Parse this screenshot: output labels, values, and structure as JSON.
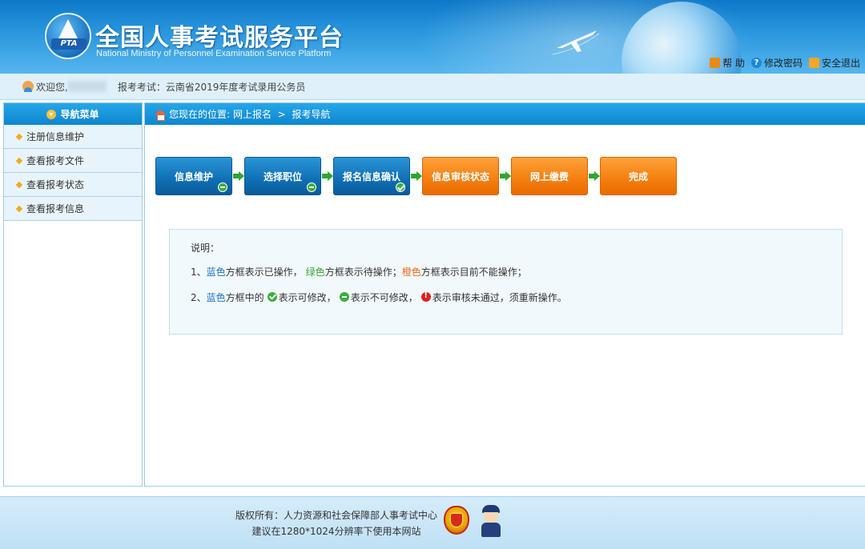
{
  "header": {
    "title": "全国人事考试服务平台",
    "subtitle": "National Ministry of Personnel Examination Service Platform",
    "logo_text": "PTA",
    "links": [
      {
        "label": "帮 助",
        "icon": "lock-icon"
      },
      {
        "label": "修改密码",
        "icon": "question-icon"
      },
      {
        "label": "安全退出",
        "icon": "exit-icon"
      }
    ]
  },
  "welcome": {
    "greeting": "欢迎您,",
    "exam_label": "报考考试：",
    "exam_name": "云南省2019年度考试录用公务员"
  },
  "sidebar": {
    "title": "导航菜单",
    "items": [
      {
        "label": "注册信息维护"
      },
      {
        "label": "查看报考文件"
      },
      {
        "label": "查看报考状态"
      },
      {
        "label": "查看报考信息"
      }
    ]
  },
  "breadcrumb": {
    "prefix": "您现在的位置:",
    "path": "网上报名  >  报考导航"
  },
  "steps": [
    {
      "label": "信息维护",
      "color": "blue",
      "badge": "minus"
    },
    {
      "label": "选择职位",
      "color": "blue",
      "badge": "minus"
    },
    {
      "label": "报名信息确认",
      "color": "blue",
      "badge": "check"
    },
    {
      "label": "信息审核状态",
      "color": "orange",
      "badge": ""
    },
    {
      "label": "网上缴费",
      "color": "orange",
      "badge": ""
    },
    {
      "label": "完成",
      "color": "orange",
      "badge": ""
    }
  ],
  "notes": {
    "title": "说明：",
    "line1": {
      "num": "1、",
      "blue": "蓝色",
      "t1": "方框表示已操作，",
      "green": "绿色",
      "t2": "方框表示待操作；",
      "orange": "橙色",
      "t3": "方框表示目前不能操作；"
    },
    "line2": {
      "num": "2、",
      "blue": "蓝色",
      "t1": "方框中的",
      "t2": "表示可修改，",
      "t3": "表示不可修改，",
      "t4": "表示审核未通过，须重新操作。"
    }
  },
  "footer": {
    "copyright": "版权所有：人力资源和社会保障部人事考试中心",
    "advice": "建议在1280*1024分辨率下使用本网站"
  },
  "colors": {
    "blue_step": "#0f6fb5",
    "orange_step": "#f47e10",
    "nav_blue": "#0d86d0",
    "green_arrow": "#2ea62e"
  }
}
